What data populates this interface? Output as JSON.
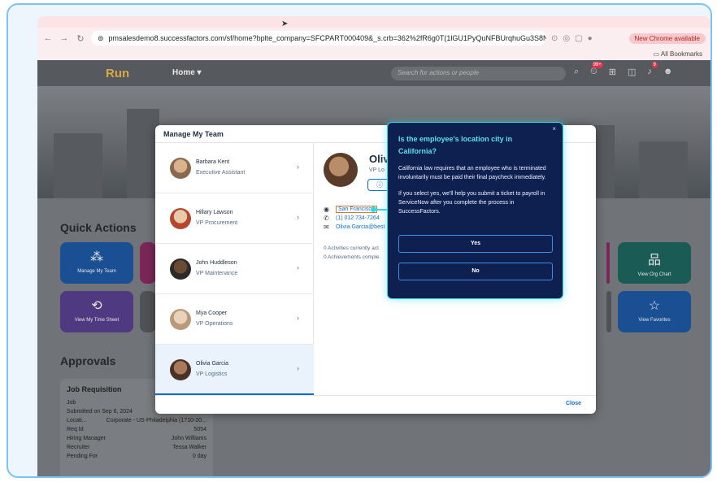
{
  "browser": {
    "url": "pmsalesdemo8.successfactors.com/sf/home?bplte_company=SFCPART000409&_s.crb=362%2fR6g0T(1lGU1PyQuNFBUrqhuGu3S8Ntv1Ot...",
    "update_badge": "New Chrome available",
    "bookmarks_label": "All Bookmarks"
  },
  "shell": {
    "logo": "Run",
    "home_menu": "Home ▾",
    "search_placeholder": "Search for actions or people",
    "notif_count_1": "99+",
    "notif_count_2": "9"
  },
  "quick_actions": {
    "title": "Quick Actions",
    "tiles": [
      "Manage My Team",
      "View Org Chart",
      "View My Time Sheet",
      "View Favorites"
    ]
  },
  "approvals": {
    "title": "Approvals",
    "card_title": "Job Requisition",
    "card_subtitle": "Job",
    "submitted": "Submitted on Sep 6, 2024",
    "rows": [
      {
        "label": "Locati...",
        "value": "Corporate - US-Philadelphia (1710-20..."
      },
      {
        "label": "Req Id",
        "value": "5054"
      },
      {
        "label": "Hiring Manager",
        "value": "John Williams"
      },
      {
        "label": "Recruiter",
        "value": "Tessa Walker"
      },
      {
        "label": "Pending For",
        "value": "0 day"
      }
    ]
  },
  "dialog": {
    "title": "Manage My Team",
    "close_label": "Close",
    "team": [
      {
        "name": "Barbara Kent",
        "role": "Executive Assistant"
      },
      {
        "name": "Hillary Lawson",
        "role": "VP Procurement"
      },
      {
        "name": "John Huddleson",
        "role": "VP Maintenance"
      },
      {
        "name": "Mya Cooper",
        "role": "VP Operations"
      },
      {
        "name": "Olivia Garcia",
        "role": "VP Logistics"
      }
    ],
    "detail": {
      "name": "Oliv",
      "role": "VP Lo",
      "city": "San Francisco",
      "phone": "(1) 012 734-7264",
      "email": "Olivia.Garcia@best",
      "activities": "0 Activities currently act",
      "achievements": "0 Achievements comple"
    }
  },
  "popup": {
    "title": "Is the employee's location city in California?",
    "body": "California law requires that an employee who is terminated involuntarily must be paid their final paycheck immediately.",
    "body2": "If you select yes, we'll help you submit a ticket to payroll in ServiceNow after you complete the process in SuccessFactors.",
    "yes_label": "Yes",
    "no_label": "No",
    "close_icon": "×"
  },
  "colors": {
    "popup_bg": "#0d2050",
    "popup_accent": "#30d9e8",
    "sap_blue": "#0a6ed1",
    "tile_blue": "#1565c0",
    "tile_teal": "#00796b",
    "tile_purple": "#6a3aa8",
    "tile_magenta": "#a0176d"
  }
}
